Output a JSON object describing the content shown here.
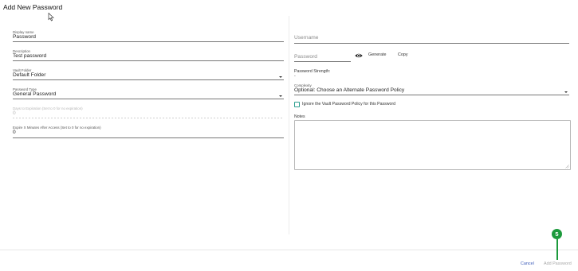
{
  "dialog": {
    "title": "Add New Password"
  },
  "left": {
    "display_name": {
      "label": "Display name",
      "value": "Password"
    },
    "description": {
      "label": "Description",
      "value": "Test password"
    },
    "vault_folder": {
      "label": "Vault Folder",
      "value": "Default Folder"
    },
    "password_type": {
      "label": "Password Type",
      "value": "General Password"
    },
    "days_to_expiration": {
      "label": "Days to Expiration (Set to 0 for no expiration)",
      "value": "0"
    },
    "expire_minutes": {
      "label": "Expire X Minutes After Access (Set to 0 for no expiration)",
      "value": "0"
    }
  },
  "right": {
    "username": {
      "placeholder": "Username"
    },
    "password": {
      "placeholder": "Password"
    },
    "generate_label": "Generate",
    "copy_label": "Copy",
    "strength_label": "Password Strength:",
    "strength_value": "-",
    "complexity": {
      "label": "Complexity",
      "value": "Optional: Choose an Alternate Password Policy"
    },
    "ignore_policy_label": "Ignore the Vault Password Policy for this Password",
    "notes_label": "Notes"
  },
  "footer": {
    "cancel_label": "Cancel",
    "add_label": "Add Password",
    "step_badge": "5"
  },
  "colors": {
    "badge": "#1c9a3c",
    "cancel": "#3b5bb8",
    "checkbox_border": "#2a9d8f"
  },
  "icons": [
    "cursor-icon",
    "eye-icon",
    "dropdown-caret-icon",
    "resize-handle-icon"
  ]
}
